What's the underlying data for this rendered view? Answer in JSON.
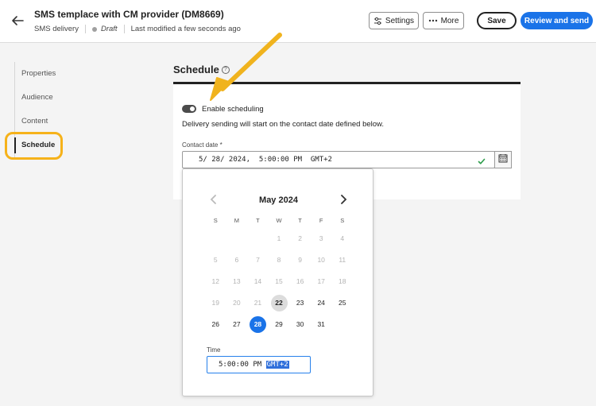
{
  "header": {
    "title": "SMS templace with CM provider (DM8669)",
    "channel": "SMS delivery",
    "status": "Draft",
    "modified": "Last modified a few seconds ago",
    "settings_label": "Settings",
    "more_label": "More",
    "save_label": "Save",
    "review_label": "Review and send"
  },
  "nav": {
    "items": [
      {
        "label": "Properties"
      },
      {
        "label": "Audience"
      },
      {
        "label": "Content"
      },
      {
        "label": "Schedule"
      }
    ],
    "active": "Schedule"
  },
  "schedule": {
    "title": "Schedule",
    "toggle_label": "Enable scheduling",
    "toggle_on": true,
    "description": "Delivery sending will start on the contact date defined below.",
    "contact_date_label": "Contact date",
    "contact_date_value": "5/ 28/ 2024,  5:00:00 PM  GMT+2"
  },
  "calendar": {
    "month": "May 2024",
    "weekdays": [
      "S",
      "M",
      "T",
      "W",
      "T",
      "F",
      "S"
    ],
    "weeks": [
      [
        {
          "d": ""
        },
        {
          "d": ""
        },
        {
          "d": ""
        },
        {
          "d": "1",
          "m": 1
        },
        {
          "d": "2",
          "m": 1
        },
        {
          "d": "3",
          "m": 1
        },
        {
          "d": "4",
          "m": 1
        }
      ],
      [
        {
          "d": "5",
          "m": 1
        },
        {
          "d": "6",
          "m": 1
        },
        {
          "d": "7",
          "m": 1
        },
        {
          "d": "8",
          "m": 1
        },
        {
          "d": "9",
          "m": 1
        },
        {
          "d": "10",
          "m": 1
        },
        {
          "d": "11",
          "m": 1
        }
      ],
      [
        {
          "d": "12",
          "m": 1
        },
        {
          "d": "13",
          "m": 1
        },
        {
          "d": "14",
          "m": 1
        },
        {
          "d": "15",
          "m": 1
        },
        {
          "d": "16",
          "m": 1
        },
        {
          "d": "17",
          "m": 1
        },
        {
          "d": "18",
          "m": 1
        }
      ],
      [
        {
          "d": "19",
          "m": 1
        },
        {
          "d": "20",
          "m": 1
        },
        {
          "d": "21",
          "m": 1
        },
        {
          "d": "22",
          "today": 1
        },
        {
          "d": "23"
        },
        {
          "d": "24"
        },
        {
          "d": "25"
        }
      ],
      [
        {
          "d": "26"
        },
        {
          "d": "27"
        },
        {
          "d": "28",
          "sel": 1
        },
        {
          "d": "29"
        },
        {
          "d": "30"
        },
        {
          "d": "31"
        },
        {
          "d": ""
        }
      ]
    ],
    "time_label": "Time",
    "time_value": "5:00:00 PM",
    "timezone": "GMT+2"
  },
  "colors": {
    "accent": "#1a73e8",
    "highlight": "#f6b21a"
  }
}
